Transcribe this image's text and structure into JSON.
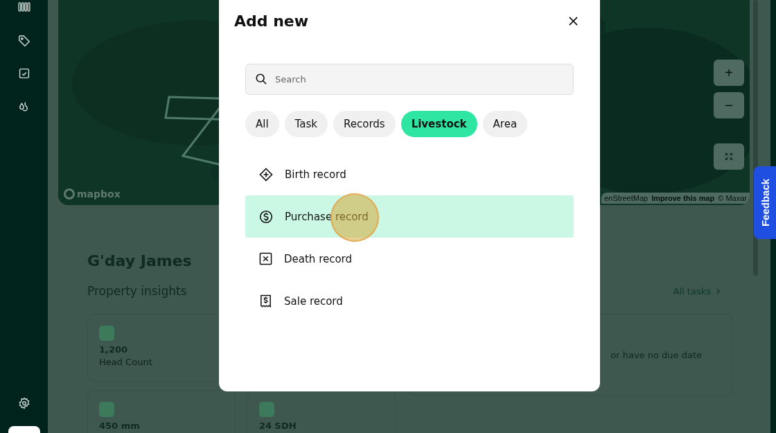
{
  "map": {
    "logo": "mapbox",
    "attribution": [
      "enStreetMap",
      "Improve this map",
      "© Maxar"
    ],
    "controls": [
      "+",
      "−"
    ]
  },
  "feedback": {
    "label": "Feedback"
  },
  "dashboard": {
    "greeting": "G'day James",
    "section_title": "Property insights",
    "tasks_link": "All tasks",
    "stats": [
      {
        "value": "1,200",
        "label": "Head Count"
      },
      {
        "value": "450  mm"
      },
      {
        "value": "24  SDH"
      }
    ],
    "tasks_note": "or have no due date"
  },
  "dialog": {
    "title": "Add new",
    "search": {
      "placeholder": "Search"
    },
    "filters": [
      {
        "label": "All",
        "selected": false
      },
      {
        "label": "Task",
        "selected": false
      },
      {
        "label": "Records",
        "selected": false
      },
      {
        "label": "Livestock",
        "selected": true
      },
      {
        "label": "Area",
        "selected": false
      }
    ],
    "items": [
      {
        "kind": "birth",
        "label": "Birth record",
        "selected": false
      },
      {
        "kind": "purchase",
        "label": "Purchase record",
        "selected": true
      },
      {
        "kind": "death",
        "label": "Death record",
        "selected": false
      },
      {
        "kind": "sale",
        "label": "Sale record",
        "selected": false
      }
    ]
  }
}
